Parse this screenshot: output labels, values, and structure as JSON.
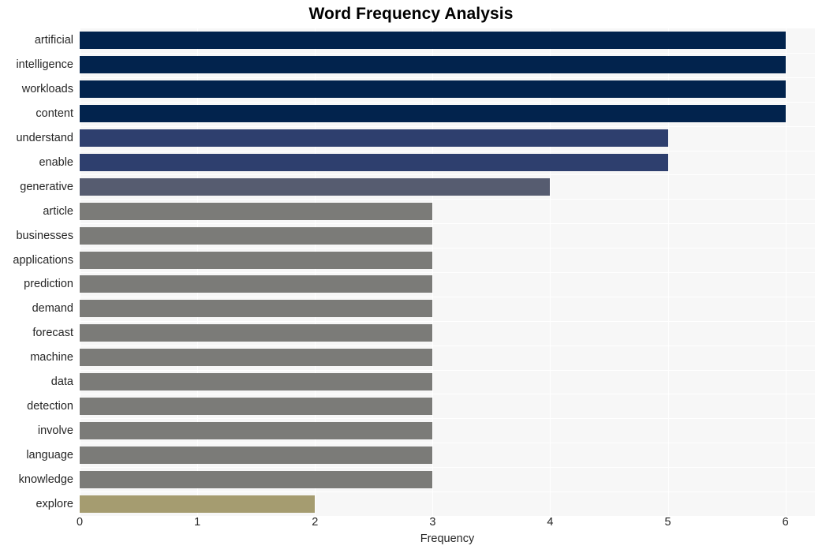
{
  "chart_data": {
    "type": "bar",
    "orientation": "horizontal",
    "title": "Word Frequency Analysis",
    "xlabel": "Frequency",
    "ylabel": "",
    "xlim": [
      0,
      6.25
    ],
    "ylim": [
      0,
      20
    ],
    "xticks": [
      "0",
      "1",
      "2",
      "3",
      "4",
      "5",
      "6"
    ],
    "xtick_values": [
      0,
      1,
      2,
      3,
      4,
      5,
      6
    ],
    "grid": true,
    "grid_color": "#ffffff",
    "plot_background": "#f7f7f7",
    "legend": null,
    "categories": [
      "artificial",
      "intelligence",
      "workloads",
      "content",
      "understand",
      "enable",
      "generative",
      "article",
      "businesses",
      "applications",
      "prediction",
      "demand",
      "forecast",
      "machine",
      "data",
      "detection",
      "involve",
      "language",
      "knowledge",
      "explore"
    ],
    "values": [
      6,
      6,
      6,
      6,
      5,
      5,
      4,
      3,
      3,
      3,
      3,
      3,
      3,
      3,
      3,
      3,
      3,
      3,
      3,
      2
    ],
    "bar_colors": [
      "#02234d",
      "#02234d",
      "#02234d",
      "#02234d",
      "#2e3f6e",
      "#2e3f6e",
      "#565c70",
      "#7b7b78",
      "#7b7b78",
      "#7b7b78",
      "#7b7b78",
      "#7b7b78",
      "#7b7b78",
      "#7b7b78",
      "#7b7b78",
      "#7b7b78",
      "#7b7b78",
      "#7b7b78",
      "#7b7b78",
      "#a59c70"
    ]
  }
}
